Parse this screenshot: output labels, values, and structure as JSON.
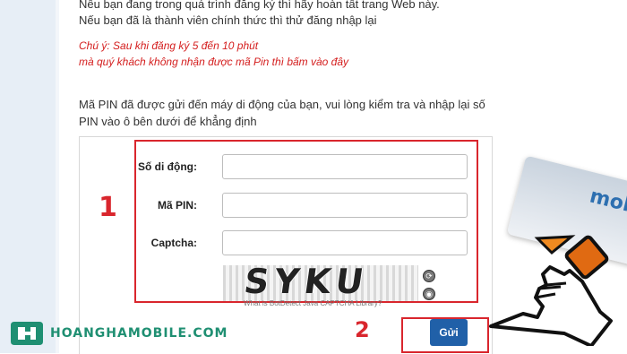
{
  "intro": {
    "line1": "Nếu bạn đang trong quá trình đăng ký thì hãy hoàn tất trang Web này.",
    "line2": "Nếu bạn đã là thành viên chính thức thì thử đăng nhập lại"
  },
  "note": {
    "line1": "Chú ý: Sau khi đăng ký 5 đến 10 phút",
    "line2": "mà quý khách không nhận được mã Pin thì bấm vào đây"
  },
  "pin_message": "Mã PIN đã được gửi đến máy di động của bạn, vui lòng kiểm tra và nhập lại số PIN vào ô bên dưới để khẳng định",
  "form": {
    "phone_label": "Số di động:",
    "phone_value": "",
    "pin_label": "Mã PIN:",
    "pin_value": "",
    "captcha_label": "Captcha:",
    "captcha_value": "",
    "captcha_image_text": "SYKU",
    "captcha_link": "What is BotDetect Java CAPTCHA Library?",
    "submit_label": "Gửi"
  },
  "annotations": {
    "step1": "1",
    "step2": "2"
  },
  "brand": {
    "part1": "HOANGHA",
    "part2": "MOBILE.COM"
  },
  "phone_card_logo": "mob",
  "colors": {
    "highlight": "#d9262d",
    "note_text": "#d41e1e",
    "button": "#2060a8",
    "brand": "#1f8f72"
  }
}
